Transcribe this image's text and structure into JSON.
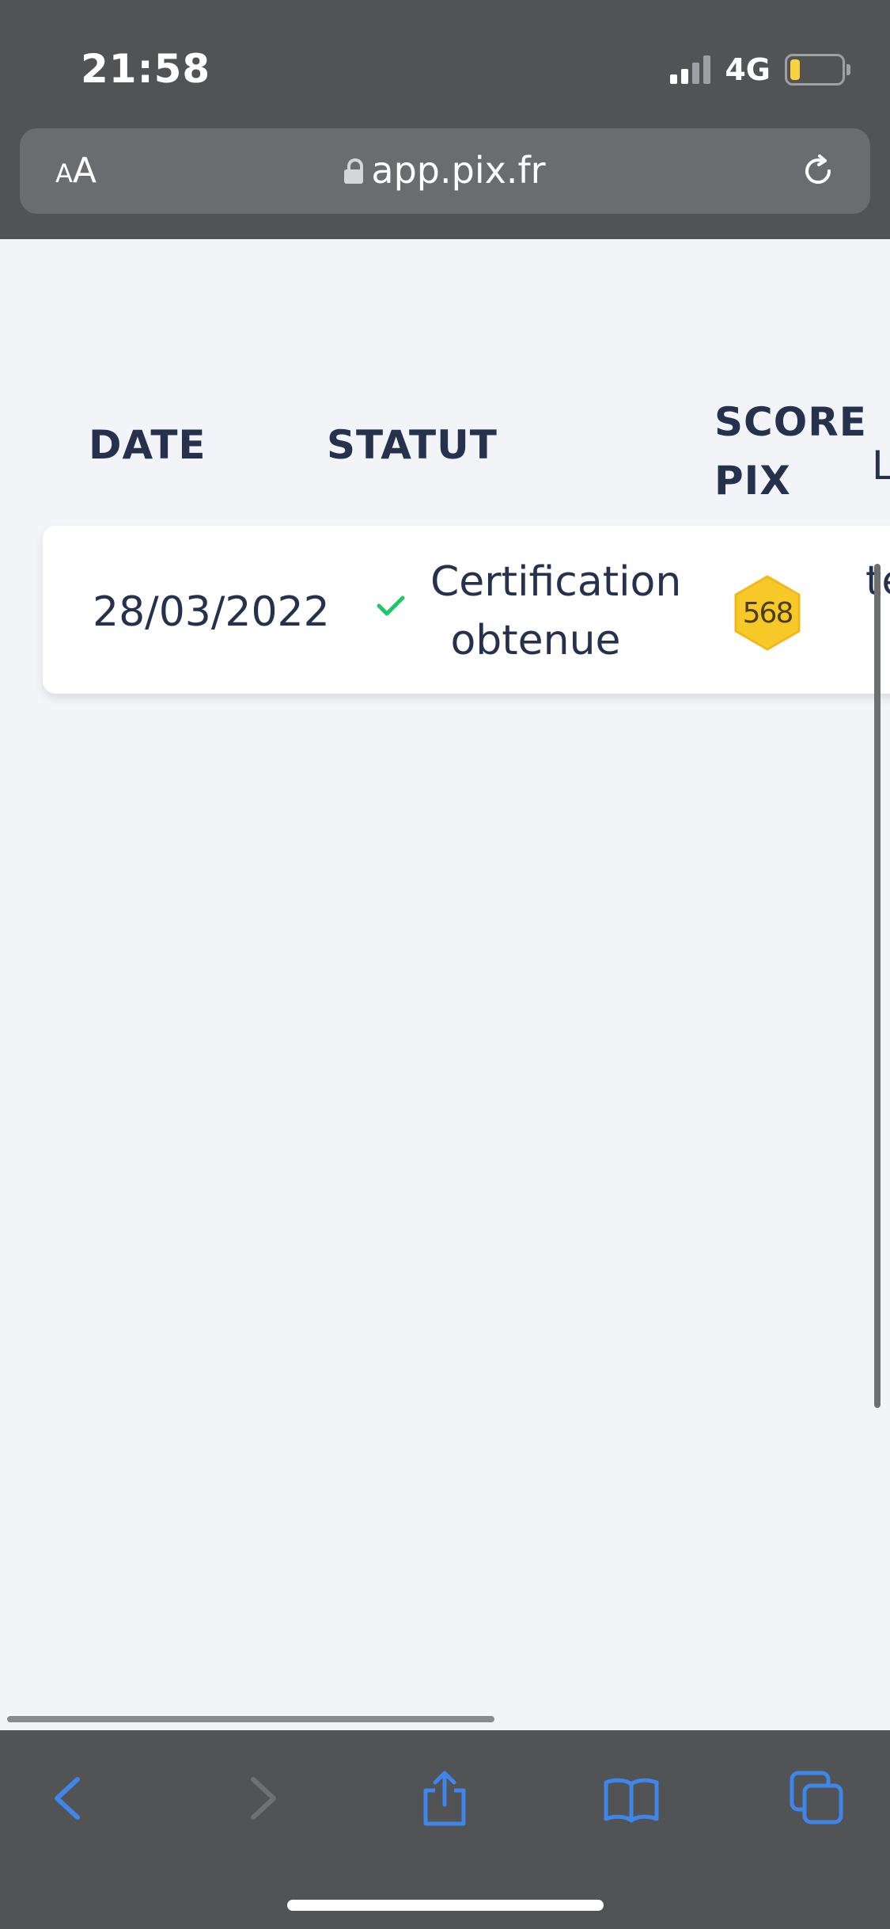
{
  "status_bar": {
    "time": "21:58",
    "network": "4G",
    "signal_bars_active": 2,
    "signal_bars_total": 4,
    "battery_level": 0.2,
    "battery_color": "#f9d23d"
  },
  "browser": {
    "text_size_button": {
      "small": "A",
      "large": "A"
    },
    "url": "app.pix.fr"
  },
  "table": {
    "headers": {
      "date": "DATE",
      "status": "STATUT",
      "score_line1": "SCORE",
      "score_line2": "PIX",
      "next_partial": "L"
    },
    "rows": [
      {
        "date": "28/03/2022",
        "status_line1": "Certification",
        "status_line2": "obtenue",
        "score": "568",
        "next_partial": "te"
      }
    ]
  },
  "colors": {
    "chrome": "#525355",
    "page_background": "#f3f4f7",
    "text_primary": "#26324d",
    "success": "#1fc766",
    "badge_fill": "#f7c928",
    "toolbar_icon": "#3f86ea",
    "toolbar_icon_disabled": "#6f7073"
  },
  "toolbar": {
    "icons": [
      "back-icon",
      "forward-icon",
      "share-icon",
      "bookmarks-icon",
      "tabs-icon"
    ]
  }
}
